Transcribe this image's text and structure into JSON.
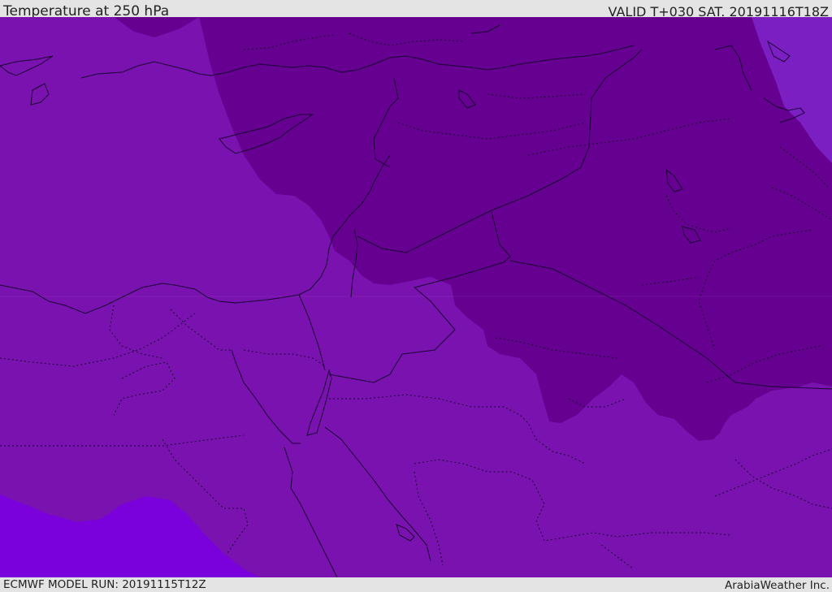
{
  "header": {
    "title": "Temperature at 250 hPa",
    "valid": "VALID T+030 SAT. 20191116T18Z"
  },
  "footer": {
    "model_run": "ECMWF MODEL RUN: 20191115T12Z",
    "credit": "ArabiaWeather Inc."
  },
  "map": {
    "variable": "Temperature",
    "level": "250 hPa",
    "colors": {
      "mid_band": "#7a12b0",
      "cold_band": "#650090",
      "warm_band": "#7a00dc",
      "light_band": "#7b1ec2",
      "boundary": "#1a0033"
    }
  }
}
